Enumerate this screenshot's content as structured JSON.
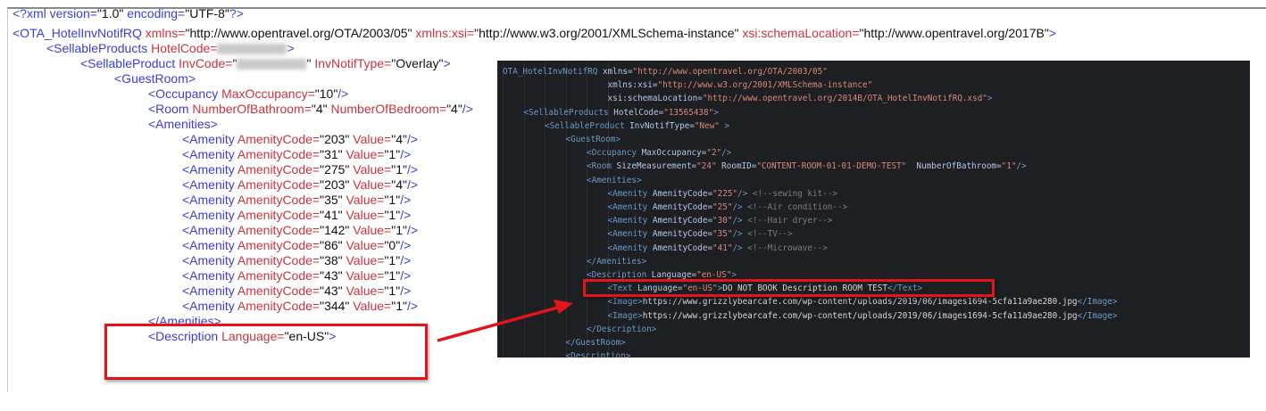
{
  "left_panel": {
    "lines": [
      {
        "indent": 0,
        "tokens": [
          {
            "t": "tag",
            "s": "<?xml "
          },
          {
            "t": "tag",
            "s": "version="
          },
          {
            "t": "val",
            "s": "\"1.0\""
          },
          {
            "t": "tag",
            "s": " encoding="
          },
          {
            "t": "val",
            "s": "\"UTF-8\""
          },
          {
            "t": "tag",
            "s": "?>"
          }
        ]
      },
      {
        "indent": 0,
        "tokens": [
          {
            "t": "tag",
            "s": "<OTA_HotelInvNotifRQ "
          },
          {
            "t": "attr",
            "s": "xmlns="
          },
          {
            "t": "val",
            "s": "\"http://www.opentravel.org/OTA/2003/05\" "
          },
          {
            "t": "attr",
            "s": "xmlns:xsi="
          },
          {
            "t": "val",
            "s": "\"http://www.w3.org/2001/XMLSchema-instance\" "
          },
          {
            "t": "attr",
            "s": "xsi:schemaLocation="
          },
          {
            "t": "val",
            "s": "\"http://www.opentravel.org/2017B\""
          },
          {
            "t": "tag",
            "s": ">"
          }
        ]
      },
      {
        "indent": 1,
        "tokens": [
          {
            "t": "tag",
            "s": "<SellableProducts "
          },
          {
            "t": "attr",
            "s": "HotelCode="
          },
          {
            "t": "redact",
            "s": ""
          },
          {
            "t": "tag",
            "s": ">"
          }
        ]
      },
      {
        "indent": 2,
        "tokens": [
          {
            "t": "tag",
            "s": "<SellableProduct "
          },
          {
            "t": "attr",
            "s": "InvCode="
          },
          {
            "t": "val",
            "s": "\""
          },
          {
            "t": "redact",
            "s": ""
          },
          {
            "t": "val",
            "s": "\" "
          },
          {
            "t": "attr",
            "s": "InvNotifType="
          },
          {
            "t": "val",
            "s": "\"Overlay\""
          },
          {
            "t": "tag",
            "s": ">"
          }
        ]
      },
      {
        "indent": 3,
        "tokens": [
          {
            "t": "tag",
            "s": "<GuestRoom>"
          }
        ]
      },
      {
        "indent": 4,
        "tokens": [
          {
            "t": "tag",
            "s": "<Occupancy "
          },
          {
            "t": "attr",
            "s": "MaxOccupancy="
          },
          {
            "t": "val",
            "s": "\"10\""
          },
          {
            "t": "tag",
            "s": "/>"
          }
        ]
      },
      {
        "indent": 4,
        "tokens": [
          {
            "t": "tag",
            "s": "<Room "
          },
          {
            "t": "attr",
            "s": "NumberOfBathroom="
          },
          {
            "t": "val",
            "s": "\"4\" "
          },
          {
            "t": "attr",
            "s": "NumberOfBedroom="
          },
          {
            "t": "val",
            "s": "\"4\""
          },
          {
            "t": "tag",
            "s": "/>"
          }
        ]
      },
      {
        "indent": 4,
        "tokens": [
          {
            "t": "tag",
            "s": "<Amenities>"
          }
        ]
      },
      {
        "indent": 5,
        "tokens": [
          {
            "t": "tag",
            "s": "<Amenity "
          },
          {
            "t": "attr",
            "s": "AmenityCode="
          },
          {
            "t": "val",
            "s": "\"203\" "
          },
          {
            "t": "attr",
            "s": "Value="
          },
          {
            "t": "val",
            "s": "\"4\""
          },
          {
            "t": "tag",
            "s": "/>"
          }
        ]
      },
      {
        "indent": 5,
        "tokens": [
          {
            "t": "tag",
            "s": "<Amenity "
          },
          {
            "t": "attr",
            "s": "AmenityCode="
          },
          {
            "t": "val",
            "s": "\"31\" "
          },
          {
            "t": "attr",
            "s": "Value="
          },
          {
            "t": "val",
            "s": "\"1\""
          },
          {
            "t": "tag",
            "s": "/>"
          }
        ]
      },
      {
        "indent": 5,
        "tokens": [
          {
            "t": "tag",
            "s": "<Amenity "
          },
          {
            "t": "attr",
            "s": "AmenityCode="
          },
          {
            "t": "val",
            "s": "\"275\" "
          },
          {
            "t": "attr",
            "s": "Value="
          },
          {
            "t": "val",
            "s": "\"1\""
          },
          {
            "t": "tag",
            "s": "/>"
          }
        ]
      },
      {
        "indent": 5,
        "tokens": [
          {
            "t": "tag",
            "s": "<Amenity "
          },
          {
            "t": "attr",
            "s": "AmenityCode="
          },
          {
            "t": "val",
            "s": "\"203\" "
          },
          {
            "t": "attr",
            "s": "Value="
          },
          {
            "t": "val",
            "s": "\"4\""
          },
          {
            "t": "tag",
            "s": "/>"
          }
        ]
      },
      {
        "indent": 5,
        "tokens": [
          {
            "t": "tag",
            "s": "<Amenity "
          },
          {
            "t": "attr",
            "s": "AmenityCode="
          },
          {
            "t": "val",
            "s": "\"35\" "
          },
          {
            "t": "attr",
            "s": "Value="
          },
          {
            "t": "val",
            "s": "\"1\""
          },
          {
            "t": "tag",
            "s": "/>"
          }
        ]
      },
      {
        "indent": 5,
        "tokens": [
          {
            "t": "tag",
            "s": "<Amenity "
          },
          {
            "t": "attr",
            "s": "AmenityCode="
          },
          {
            "t": "val",
            "s": "\"41\" "
          },
          {
            "t": "attr",
            "s": "Value="
          },
          {
            "t": "val",
            "s": "\"1\""
          },
          {
            "t": "tag",
            "s": "/>"
          }
        ]
      },
      {
        "indent": 5,
        "tokens": [
          {
            "t": "tag",
            "s": "<Amenity "
          },
          {
            "t": "attr",
            "s": "AmenityCode="
          },
          {
            "t": "val",
            "s": "\"142\" "
          },
          {
            "t": "attr",
            "s": "Value="
          },
          {
            "t": "val",
            "s": "\"1\""
          },
          {
            "t": "tag",
            "s": "/>"
          }
        ]
      },
      {
        "indent": 5,
        "tokens": [
          {
            "t": "tag",
            "s": "<Amenity "
          },
          {
            "t": "attr",
            "s": "AmenityCode="
          },
          {
            "t": "val",
            "s": "\"86\" "
          },
          {
            "t": "attr",
            "s": "Value="
          },
          {
            "t": "val",
            "s": "\"0\""
          },
          {
            "t": "tag",
            "s": "/>"
          }
        ]
      },
      {
        "indent": 5,
        "tokens": [
          {
            "t": "tag",
            "s": "<Amenity "
          },
          {
            "t": "attr",
            "s": "AmenityCode="
          },
          {
            "t": "val",
            "s": "\"38\" "
          },
          {
            "t": "attr",
            "s": "Value="
          },
          {
            "t": "val",
            "s": "\"1\""
          },
          {
            "t": "tag",
            "s": "/>"
          }
        ]
      },
      {
        "indent": 5,
        "tokens": [
          {
            "t": "tag",
            "s": "<Amenity "
          },
          {
            "t": "attr",
            "s": "AmenityCode="
          },
          {
            "t": "val",
            "s": "\"43\" "
          },
          {
            "t": "attr",
            "s": "Value="
          },
          {
            "t": "val",
            "s": "\"1\""
          },
          {
            "t": "tag",
            "s": "/>"
          }
        ]
      },
      {
        "indent": 5,
        "tokens": [
          {
            "t": "tag",
            "s": "<Amenity "
          },
          {
            "t": "attr",
            "s": "AmenityCode="
          },
          {
            "t": "val",
            "s": "\"43\" "
          },
          {
            "t": "attr",
            "s": "Value="
          },
          {
            "t": "val",
            "s": "\"1\""
          },
          {
            "t": "tag",
            "s": "/>"
          }
        ]
      },
      {
        "indent": 5,
        "tokens": [
          {
            "t": "tag",
            "s": "<Amenity "
          },
          {
            "t": "attr",
            "s": "AmenityCode="
          },
          {
            "t": "val",
            "s": "\"344\" "
          },
          {
            "t": "attr",
            "s": "Value="
          },
          {
            "t": "val",
            "s": "\"1\""
          },
          {
            "t": "tag",
            "s": "/>"
          }
        ]
      },
      {
        "indent": 4,
        "tokens": [
          {
            "t": "tag",
            "s": "</Amenities>"
          }
        ]
      },
      {
        "indent": 4,
        "tokens": [
          {
            "t": "tag",
            "s": "<Description "
          },
          {
            "t": "attr",
            "s": "Language="
          },
          {
            "t": "val",
            "s": "\"en-US\""
          },
          {
            "t": "tag",
            "s": ">"
          }
        ]
      }
    ]
  },
  "right_panel": {
    "lines": [
      {
        "indent": 0,
        "tokens": [
          {
            "t": "tag",
            "s": "OTA_HotelInvNotifRQ "
          },
          {
            "t": "attr",
            "s": "xmlns="
          },
          {
            "t": "val",
            "s": "\"http://www.opentravel.org/OTA/2003/05\""
          }
        ]
      },
      {
        "indent": 5,
        "tokens": [
          {
            "t": "attr",
            "s": "xmlns:xsi="
          },
          {
            "t": "val",
            "s": "\"http://www.w3.org/2001/XMLSchema-instance\""
          }
        ]
      },
      {
        "indent": 5,
        "tokens": [
          {
            "t": "attr",
            "s": "xsi:schemaLocation="
          },
          {
            "t": "val",
            "s": "\"http://www.opentravel.org/2014B/OTA_HotelInvNotifRQ.xsd\""
          },
          {
            "t": "tag",
            "s": ">"
          }
        ]
      },
      {
        "indent": 1,
        "tokens": [
          {
            "t": "tag",
            "s": "<SellableProducts "
          },
          {
            "t": "attr",
            "s": "HotelCode="
          },
          {
            "t": "val",
            "s": "\"13565438\""
          },
          {
            "t": "tag",
            "s": ">"
          }
        ]
      },
      {
        "indent": 2,
        "tokens": [
          {
            "t": "tag",
            "s": "<SellableProduct "
          },
          {
            "t": "attr",
            "s": "InvNotifType="
          },
          {
            "t": "val",
            "s": "\"New\""
          },
          {
            "t": "tag",
            "s": " >"
          }
        ]
      },
      {
        "indent": 3,
        "tokens": [
          {
            "t": "tag",
            "s": "<GuestRoom>"
          }
        ]
      },
      {
        "indent": 4,
        "tokens": [
          {
            "t": "tag",
            "s": "<Occupancy "
          },
          {
            "t": "attr",
            "s": "MaxOccupancy="
          },
          {
            "t": "val",
            "s": "\"2\""
          },
          {
            "t": "tag",
            "s": "/>"
          }
        ]
      },
      {
        "indent": 4,
        "tokens": [
          {
            "t": "tag",
            "s": "<Room "
          },
          {
            "t": "attr",
            "s": "SizeMeasurement="
          },
          {
            "t": "val",
            "s": "\"24\" "
          },
          {
            "t": "attr",
            "s": "RoomID="
          },
          {
            "t": "val",
            "s": "\"CONTENT-ROOM-01-01-DEMO-TEST\"  "
          },
          {
            "t": "attr",
            "s": "NumberOfBathroom="
          },
          {
            "t": "val",
            "s": "\"1\""
          },
          {
            "t": "tag",
            "s": "/>"
          }
        ]
      },
      {
        "indent": 4,
        "tokens": [
          {
            "t": "tag",
            "s": "<Amenities>"
          }
        ]
      },
      {
        "indent": 5,
        "tokens": [
          {
            "t": "tag",
            "s": "<Amenity "
          },
          {
            "t": "attr",
            "s": "AmenityCode="
          },
          {
            "t": "val",
            "s": "\"225\""
          },
          {
            "t": "tag",
            "s": "/> "
          },
          {
            "t": "comment",
            "s": "<!--sewing kit-->"
          }
        ]
      },
      {
        "indent": 5,
        "tokens": [
          {
            "t": "tag",
            "s": "<Amenity "
          },
          {
            "t": "attr",
            "s": "AmenityCode="
          },
          {
            "t": "val",
            "s": "\"25\""
          },
          {
            "t": "tag",
            "s": "/> "
          },
          {
            "t": "comment",
            "s": "<!--Air condition-->"
          }
        ]
      },
      {
        "indent": 5,
        "tokens": [
          {
            "t": "tag",
            "s": "<Amenity "
          },
          {
            "t": "attr",
            "s": "AmenityCode="
          },
          {
            "t": "val",
            "s": "\"30\""
          },
          {
            "t": "tag",
            "s": "/> "
          },
          {
            "t": "comment",
            "s": "<!--Hair dryer-->"
          }
        ]
      },
      {
        "indent": 5,
        "tokens": [
          {
            "t": "tag",
            "s": "<Amenity "
          },
          {
            "t": "attr",
            "s": "AmenityCode="
          },
          {
            "t": "val",
            "s": "\"35\""
          },
          {
            "t": "tag",
            "s": "/> "
          },
          {
            "t": "comment",
            "s": "<!--TV-->"
          }
        ]
      },
      {
        "indent": 5,
        "tokens": [
          {
            "t": "tag",
            "s": "<Amenity "
          },
          {
            "t": "attr",
            "s": "AmenityCode="
          },
          {
            "t": "val",
            "s": "\"41\""
          },
          {
            "t": "tag",
            "s": "/> "
          },
          {
            "t": "comment",
            "s": "<!--Microwave-->"
          }
        ]
      },
      {
        "indent": 4,
        "tokens": [
          {
            "t": "tag",
            "s": "</Amenities>"
          }
        ]
      },
      {
        "indent": 4,
        "tokens": [
          {
            "t": "tag",
            "s": "<Description "
          },
          {
            "t": "attr",
            "s": "Language="
          },
          {
            "t": "val",
            "s": "\"en-US\""
          },
          {
            "t": "tag",
            "s": ">"
          }
        ]
      },
      {
        "indent": 5,
        "tokens": [
          {
            "t": "tag",
            "s": "<Text "
          },
          {
            "t": "attr",
            "s": "Language="
          },
          {
            "t": "val",
            "s": "\"en-US\""
          },
          {
            "t": "tag",
            "s": ">"
          },
          {
            "t": "text",
            "s": "DO NOT BOOK Description ROOM TEST"
          },
          {
            "t": "tag",
            "s": "</Text>"
          }
        ]
      },
      {
        "indent": 5,
        "tokens": [
          {
            "t": "tag",
            "s": "<Image>"
          },
          {
            "t": "text",
            "s": "https://www.grizzlybearcafe.com/wp-content/uploads/2019/06/images1694-5cfa11a9ae280.jpg"
          },
          {
            "t": "tag",
            "s": "</Image>"
          }
        ]
      },
      {
        "indent": 5,
        "tokens": [
          {
            "t": "tag",
            "s": "<Image>"
          },
          {
            "t": "text",
            "s": "https://www.grizzlybearcafe.com/wp-content/uploads/2019/06/images1694-5cfa11a9ae280.jpg"
          },
          {
            "t": "tag",
            "s": "</Image>"
          }
        ]
      },
      {
        "indent": 4,
        "tokens": [
          {
            "t": "tag",
            "s": "</Description>"
          }
        ]
      },
      {
        "indent": 3,
        "tokens": [
          {
            "t": "tag",
            "s": "</GuestRoom>"
          }
        ]
      },
      {
        "indent": 3,
        "tokens": [
          {
            "t": "tag",
            "s": "<Description>"
          }
        ]
      }
    ]
  },
  "colors": {
    "highlight": "#e4141b",
    "editor_bg": "#1e1f22"
  }
}
